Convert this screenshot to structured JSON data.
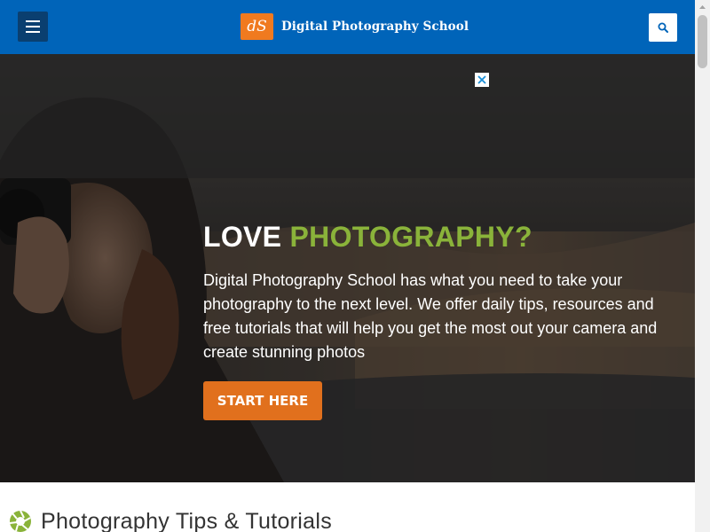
{
  "header": {
    "logo_text": "dS",
    "site_name": "Digital Photography School",
    "menu_icon": "hamburger-icon",
    "search_icon": "search-icon",
    "colors": {
      "bar": "#0064b9",
      "menu_button": "#0a3f70",
      "logo": "#f07a1f"
    }
  },
  "hero": {
    "title_part1": "LOVE",
    "title_part2": "PHOTOGRAPHY?",
    "text": "Digital Photography School has what you need to take your photography to the next level. We offer daily tips, resources and free tutorials that will help you get the most out your camera and create stunning photos",
    "cta_label": "START HERE",
    "ad_close_icon": "close-icon",
    "colors": {
      "accent": "#8ab33a",
      "cta": "#e1701d"
    }
  },
  "section": {
    "icon": "aperture-icon",
    "title": "Photography Tips & Tutorials"
  }
}
